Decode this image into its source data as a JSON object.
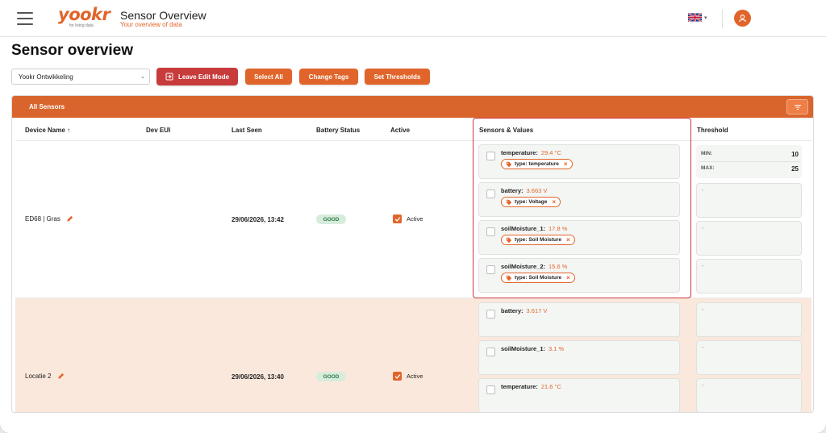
{
  "header": {
    "logo": "yookr",
    "logo_tagline": "for living data",
    "title": "Sensor Overview",
    "subtitle": "Your overview of data",
    "language_caret": "▾"
  },
  "page": {
    "title": "Sensor overview"
  },
  "toolbar": {
    "organization_select": "Yookr Ontwikkeling",
    "leave_edit_mode": "Leave Edit Mode",
    "select_all": "Select All",
    "change_tags": "Change Tags",
    "set_thresholds": "Set Thresholds"
  },
  "table": {
    "tab_label": "All Sensors",
    "columns": {
      "device_name": "Device Name ↑",
      "dev_eui": "Dev EUI",
      "last_seen": "Last Seen",
      "battery_status": "Battery Status",
      "active": "Active",
      "sensors_values": "Sensors & Values",
      "threshold": "Threshold"
    },
    "rows": [
      {
        "device_name": "ED68 | Gras",
        "dev_eui": "",
        "last_seen": "29/06/2026, 13:42",
        "battery": "GOOD",
        "active_label": "Active",
        "sensors": [
          {
            "name": "temperature:",
            "value": "29.4 °C",
            "tag": "type: temperature"
          },
          {
            "name": "battery:",
            "value": "3.663 V",
            "tag": "type: Voltage"
          },
          {
            "name": "soilMoisture_1:",
            "value": "17.8 %",
            "tag": "type: Soil Moisture"
          },
          {
            "name": "soilMoisture_2:",
            "value": "15.6 %",
            "tag": "type: Soil Moisture"
          }
        ],
        "threshold": {
          "min_label": "MIN:",
          "min_value": "10",
          "max_label": "MAX:",
          "max_value": "25",
          "empty": [
            "-",
            "-",
            "-"
          ]
        }
      },
      {
        "device_name": "Locatie 2",
        "dev_eui": "",
        "last_seen": "29/06/2026, 13:40",
        "battery": "GOOD",
        "active_label": "Active",
        "sensors": [
          {
            "name": "battery:",
            "value": "3.617 V"
          },
          {
            "name": "soilMoisture_1:",
            "value": "3.1 %"
          },
          {
            "name": "temperature:",
            "value": "21.6 °C"
          }
        ],
        "threshold": {
          "empty": [
            "-",
            "-",
            "-"
          ]
        }
      }
    ]
  },
  "colors": {
    "brand_orange": "#e1652b",
    "leave_button_red": "#c83b3b",
    "highlight_red": "#c8373f",
    "row_highlight": "#fbe8dc",
    "badge_green_bg": "#d7ecdc"
  }
}
